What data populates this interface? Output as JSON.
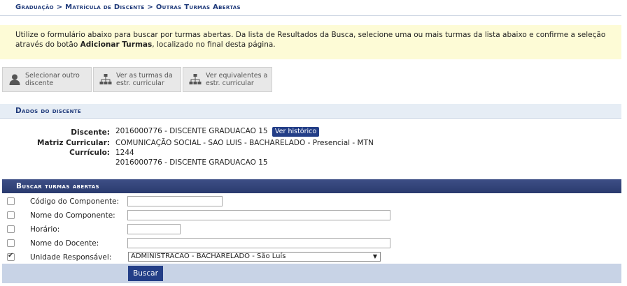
{
  "breadcrumb": "Graduação > Matrícula de Discente > Outras Turmas Abertas",
  "info": {
    "before": "Utilize o formulário abaixo para buscar por turmas abertas. Da lista de Resultados da Busca, selecione uma ou mais turmas da lista abaixo e confirme a seleção através do botão ",
    "bold": "Adicionar Turmas",
    "after": ", localizado no final desta página."
  },
  "options": [
    {
      "label": "Selecionar outro\ndiscente",
      "icon": "user-icon"
    },
    {
      "label": "Ver as turmas da\nestr. curricular",
      "icon": "hierarchy-icon"
    },
    {
      "label": "Ver equivalentes a\nestr. curricular",
      "icon": "hierarchy-icon"
    }
  ],
  "student": {
    "section_title": "Dados do discente",
    "discente_label": "Discente:",
    "discente_value": "2016000776 - DISCENTE GRADUACAO 15",
    "historico_button": "Ver histórico",
    "matriz_label": "Matriz Curricular:",
    "matriz_value": "COMUNICAÇÃO SOCIAL - SAO LUIS - BACHARELADO - Presencial - MTN",
    "curriculo_label": "Currículo:",
    "curriculo_value": "1244",
    "extra_value": "2016000776 - DISCENTE GRADUACAO 15"
  },
  "search": {
    "title": "Buscar turmas abertas",
    "fields": [
      {
        "label": "Código do Componente:",
        "checked": false,
        "value": ""
      },
      {
        "label": "Nome do Componente:",
        "checked": false,
        "value": ""
      },
      {
        "label": "Horário:",
        "checked": false,
        "value": ""
      },
      {
        "label": "Nome do Docente:",
        "checked": false,
        "value": ""
      },
      {
        "label": "Unidade Responsável:",
        "checked": true,
        "value": "ADMINISTRACAO - BACHARELADO - São Luís"
      }
    ],
    "submit_label": "Buscar"
  }
}
